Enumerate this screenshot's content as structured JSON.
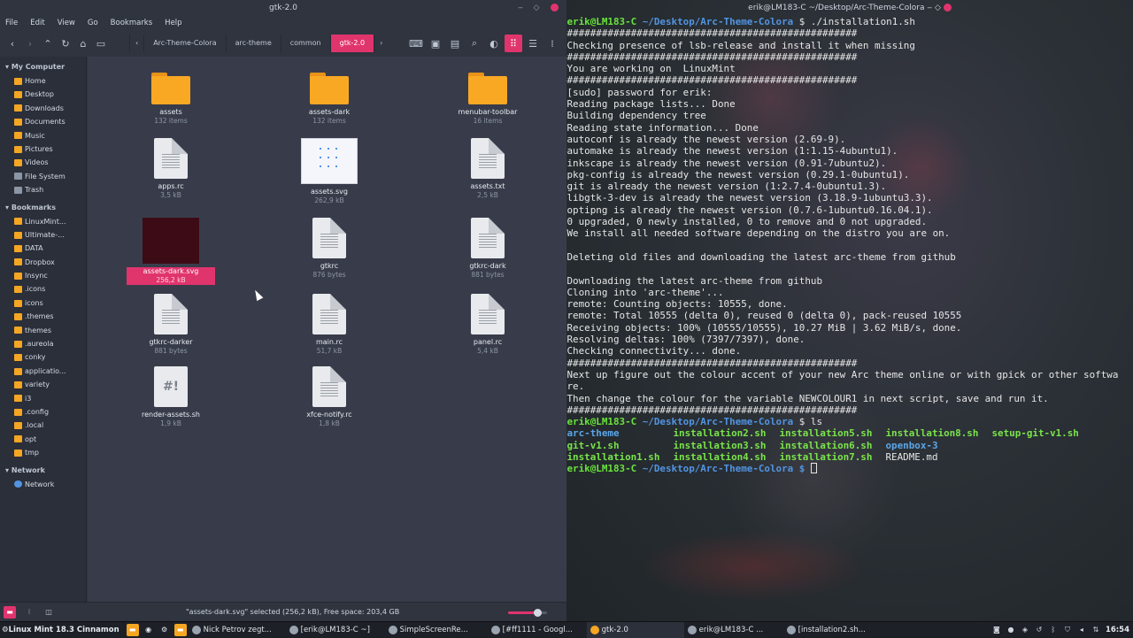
{
  "file_manager": {
    "title": "gtk-2.0",
    "menu": [
      "File",
      "Edit",
      "View",
      "Go",
      "Bookmarks",
      "Help"
    ],
    "breadcrumbs": [
      "Arc-Theme-Colora",
      "arc-theme",
      "common",
      "gtk-2.0"
    ],
    "sidebar": {
      "my_computer_label": "My Computer",
      "my_computer": [
        "Home",
        "Desktop",
        "Downloads",
        "Documents",
        "Music",
        "Pictures",
        "Videos",
        "File System",
        "Trash"
      ],
      "bookmarks_label": "Bookmarks",
      "bookmarks": [
        "LinuxMint...",
        "Ultimate-...",
        "DATA",
        "Dropbox",
        "Insync",
        ".icons",
        "icons",
        ".themes",
        "themes",
        ".aureola",
        "conky",
        "applicatio...",
        "variety",
        "i3",
        ".config",
        ".local",
        "opt",
        "tmp"
      ],
      "network_label": "Network",
      "network": [
        "Network"
      ]
    },
    "files": [
      {
        "name": "assets",
        "sub": "132 items",
        "kind": "folder"
      },
      {
        "name": "assets-dark",
        "sub": "132 items",
        "kind": "folder"
      },
      {
        "name": "menubar-toolbar",
        "sub": "16 items",
        "kind": "folder"
      },
      {
        "name": "apps.rc",
        "sub": "3,5 kB",
        "kind": "file"
      },
      {
        "name": "assets.svg",
        "sub": "262,9 kB",
        "kind": "svg"
      },
      {
        "name": "assets.txt",
        "sub": "2,5 kB",
        "kind": "file"
      },
      {
        "name": "assets-dark.svg",
        "sub": "256,2 kB",
        "kind": "svg-dark",
        "selected": true
      },
      {
        "name": "gtkrc",
        "sub": "876 bytes",
        "kind": "file"
      },
      {
        "name": "gtkrc-dark",
        "sub": "881 bytes",
        "kind": "file"
      },
      {
        "name": "gtkrc-darker",
        "sub": "881 bytes",
        "kind": "file"
      },
      {
        "name": "main.rc",
        "sub": "51,7 kB",
        "kind": "file"
      },
      {
        "name": "panel.rc",
        "sub": "5,4 kB",
        "kind": "file"
      },
      {
        "name": "render-assets.sh",
        "sub": "1,9 kB",
        "kind": "script"
      },
      {
        "name": "xfce-notify.rc",
        "sub": "1,8 kB",
        "kind": "file"
      }
    ],
    "status_text": "\"assets-dark.svg\" selected (256,2 kB), Free space: 203,4 GB",
    "zoom_level": 0.75,
    "accent_color": "#e0346d"
  },
  "terminal": {
    "title": "erik@LM183-C ~/Desktop/Arc-Theme-Colora",
    "prompt_user": "erik@LM183-C",
    "prompt_path": "~/Desktop/Arc-Theme-Colora",
    "first_command": "$ ./installation1.sh",
    "output": [
      "##################################################",
      "Checking presence of lsb-release and install it when missing",
      "##################################################",
      "You are working on  LinuxMint",
      "##################################################",
      "[sudo] password for erik:",
      "Reading package lists... Done",
      "Building dependency tree",
      "Reading state information... Done",
      "autoconf is already the newest version (2.69-9).",
      "automake is already the newest version (1:1.15-4ubuntu1).",
      "inkscape is already the newest version (0.91-7ubuntu2).",
      "pkg-config is already the newest version (0.29.1-0ubuntu1).",
      "git is already the newest version (1:2.7.4-0ubuntu1.3).",
      "libgtk-3-dev is already the newest version (3.18.9-1ubuntu3.3).",
      "optipng is already the newest version (0.7.6-1ubuntu0.16.04.1).",
      "0 upgraded, 0 newly installed, 0 to remove and 0 not upgraded.",
      "We install all needed software depending on the distro you are on.",
      "",
      "Deleting old files and downloading the latest arc-theme from github",
      "",
      "Downloading the latest arc-theme from github",
      "Cloning into 'arc-theme'...",
      "remote: Counting objects: 10555, done.",
      "remote: Total 10555 (delta 0), reused 0 (delta 0), pack-reused 10555",
      "Receiving objects: 100% (10555/10555), 10.27 MiB | 3.62 MiB/s, done.",
      "Resolving deltas: 100% (7397/7397), done.",
      "Checking connectivity... done.",
      "##################################################",
      "Next up figure out the colour accent of your new Arc theme online or with gpick or other softwa",
      "re.",
      "Then change the colour for the variable NEWCOLOUR1 in next script, save and run it.",
      "##################################################"
    ],
    "second_command": "$ ls",
    "ls_rows": [
      [
        {
          "t": "arc-theme",
          "c": "dir"
        },
        {
          "t": "installation2.sh",
          "c": "exe"
        },
        {
          "t": "installation5.sh",
          "c": "exe"
        },
        {
          "t": "installation8.sh",
          "c": "exe"
        },
        {
          "t": "setup-git-v1.sh",
          "c": "exe"
        }
      ],
      [
        {
          "t": "git-v1.sh",
          "c": "exe"
        },
        {
          "t": "installation3.sh",
          "c": "exe"
        },
        {
          "t": "installation6.sh",
          "c": "exe"
        },
        {
          "t": "openbox-3",
          "c": "dir"
        },
        {
          "t": "",
          "c": ""
        }
      ],
      [
        {
          "t": "installation1.sh",
          "c": "exe"
        },
        {
          "t": "installation4.sh",
          "c": "exe"
        },
        {
          "t": "installation7.sh",
          "c": "exe"
        },
        {
          "t": "README.md",
          "c": "plain"
        },
        {
          "t": "",
          "c": ""
        }
      ]
    ],
    "last_prompt_suffix": "$ "
  },
  "taskbar": {
    "menu_label": "Linux Mint 18.3 Cinnamon",
    "tasks": [
      "Nick Petrov zegt...",
      "[erik@LM183-C ~]",
      "SimpleScreenRe...",
      "[#ff1111 - Googl...",
      "gtk-2.0",
      "erik@LM183-C ...",
      "[installation2.sh..."
    ],
    "active_task": 4,
    "clock": "16:54"
  }
}
